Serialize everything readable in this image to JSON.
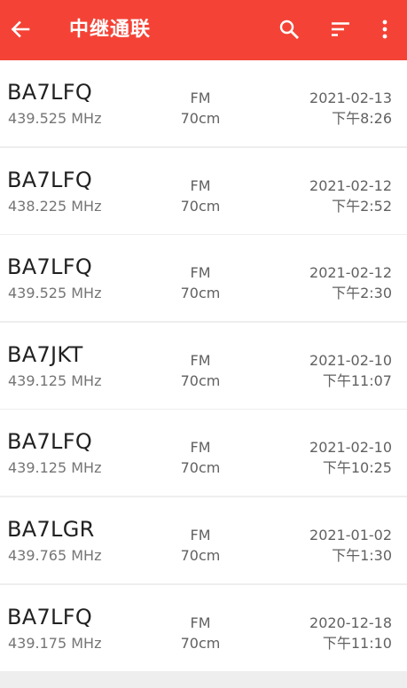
{
  "appbar": {
    "title": "中继通联",
    "color": "#f44336",
    "icons": [
      "arrow-back-icon",
      "search-icon",
      "sort-icon",
      "more-vert-icon"
    ]
  },
  "records": [
    {
      "callsign": "BA7LFQ",
      "frequency": "439.525 MHz",
      "mode": "FM",
      "band": "70cm",
      "date": "2021-02-13",
      "time": "下午8:26"
    },
    {
      "callsign": "BA7LFQ",
      "frequency": "438.225 MHz",
      "mode": "FM",
      "band": "70cm",
      "date": "2021-02-12",
      "time": "下午2:52"
    },
    {
      "callsign": "BA7LFQ",
      "frequency": "439.525 MHz",
      "mode": "FM",
      "band": "70cm",
      "date": "2021-02-12",
      "time": "下午2:30"
    },
    {
      "callsign": "BA7JKT",
      "frequency": "439.125 MHz",
      "mode": "FM",
      "band": "70cm",
      "date": "2021-02-10",
      "time": "下午11:07"
    },
    {
      "callsign": "BA7LFQ",
      "frequency": "439.125 MHz",
      "mode": "FM",
      "band": "70cm",
      "date": "2021-02-10",
      "time": "下午10:25"
    },
    {
      "callsign": "BA7LGR",
      "frequency": "439.765 MHz",
      "mode": "FM",
      "band": "70cm",
      "date": "2021-01-02",
      "time": "下午1:30"
    },
    {
      "callsign": "BA7LFQ",
      "frequency": "439.175 MHz",
      "mode": "FM",
      "band": "70cm",
      "date": "2020-12-18",
      "time": "下午11:10"
    }
  ]
}
